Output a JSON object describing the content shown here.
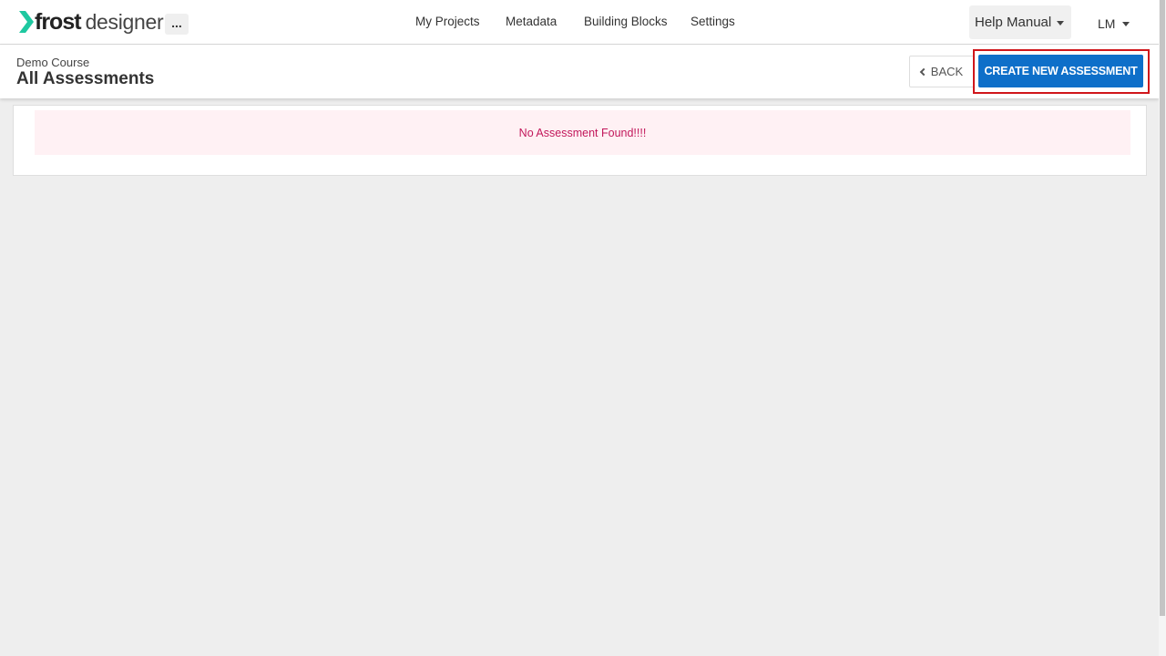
{
  "app": {
    "logo_primary": "frost",
    "logo_secondary": "designer",
    "logo_accent_color": "#1ec8a0",
    "more_label": "..."
  },
  "nav": {
    "items": [
      {
        "label": "My Projects"
      },
      {
        "label": "Metadata"
      },
      {
        "label": "Building Blocks"
      },
      {
        "label": "Settings"
      }
    ],
    "help_label": "Help Manual",
    "user_initials": "LM"
  },
  "header": {
    "breadcrumb": "Demo Course",
    "title": "All Assessments",
    "back_label": "BACK",
    "create_label": "CREATE NEW ASSESSMENT",
    "create_color": "#0e6fc9",
    "highlight_color": "#d0161b"
  },
  "content": {
    "empty_message": "No Assessment Found!!!!",
    "alert_text_color": "#c2185b",
    "alert_bg_color": "#fff1f4"
  },
  "icons": {
    "back": "chevron-left-icon",
    "dropdown": "caret-down-icon",
    "logo": "chevron-right-logo-icon"
  }
}
